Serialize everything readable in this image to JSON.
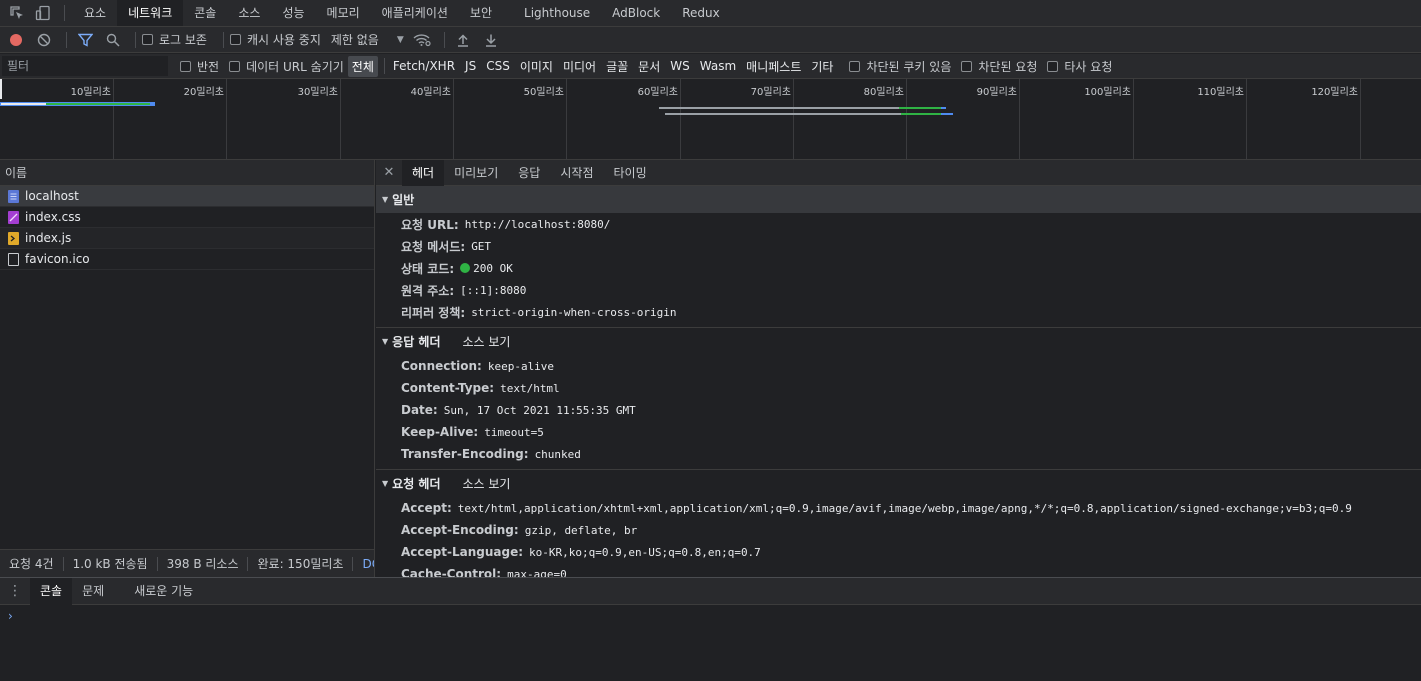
{
  "main_tabs": [
    "요소",
    "네트워크",
    "콘솔",
    "소스",
    "성능",
    "메모리",
    "애플리케이션",
    "보안",
    "Lighthouse",
    "AdBlock",
    "Redux"
  ],
  "main_tab_active": 1,
  "toolbar": {
    "preserve_log": "로그 보존",
    "disable_cache": "캐시 사용 중지",
    "throttle": "제한 없음"
  },
  "filter": {
    "placeholder": "필터",
    "invert": "반전",
    "hide_data_urls": "데이터 URL 숨기기",
    "types": [
      "전체",
      "Fetch/XHR",
      "JS",
      "CSS",
      "이미지",
      "미디어",
      "글꼴",
      "문서",
      "WS",
      "Wasm",
      "매니페스트",
      "기타"
    ],
    "blocked_cookies": "차단된 쿠키 있음",
    "blocked_requests": "차단된 요청",
    "third_party": "타사 요청"
  },
  "overview": {
    "ticks": [
      "10밀리초",
      "20밀리초",
      "30밀리초",
      "40밀리초",
      "50밀리초",
      "60밀리초",
      "70밀리초",
      "80밀리초",
      "90밀리초",
      "100밀리초",
      "110밀리초",
      "120밀리초"
    ]
  },
  "name_panel": {
    "header": "이름",
    "rows": [
      {
        "name": "localhost",
        "type": "doc"
      },
      {
        "name": "index.css",
        "type": "css"
      },
      {
        "name": "index.js",
        "type": "js"
      },
      {
        "name": "favicon.ico",
        "type": "other"
      }
    ]
  },
  "status": {
    "requests": "요청 4건",
    "transferred": "1.0 kB 전송됨",
    "resources": "398 B 리소스",
    "finish": "완료: 150밀리초",
    "dom": "DOMC"
  },
  "details": {
    "tabs": [
      "헤더",
      "미리보기",
      "응답",
      "시작점",
      "타이밍"
    ],
    "general": {
      "title": "일반",
      "url_k": "요청 URL:",
      "url_v": "http://localhost:8080/",
      "method_k": "요청 메서드:",
      "method_v": "GET",
      "status_k": "상태 코드:",
      "status_v": "200 OK",
      "remote_k": "원격 주소:",
      "remote_v": "[::1]:8080",
      "referrer_k": "리퍼러 정책:",
      "referrer_v": "strict-origin-when-cross-origin"
    },
    "response": {
      "title": "응답 헤더",
      "view_source": "소스 보기",
      "headers": [
        {
          "k": "Connection:",
          "v": "keep-alive"
        },
        {
          "k": "Content-Type:",
          "v": "text/html"
        },
        {
          "k": "Date:",
          "v": "Sun, 17 Oct 2021 11:55:35 GMT"
        },
        {
          "k": "Keep-Alive:",
          "v": "timeout=5"
        },
        {
          "k": "Transfer-Encoding:",
          "v": "chunked"
        }
      ]
    },
    "request": {
      "title": "요청 헤더",
      "view_source": "소스 보기",
      "headers": [
        {
          "k": "Accept:",
          "v": "text/html,application/xhtml+xml,application/xml;q=0.9,image/avif,image/webp,image/apng,*/*;q=0.8,application/signed-exchange;v=b3;q=0.9"
        },
        {
          "k": "Accept-Encoding:",
          "v": "gzip, deflate, br"
        },
        {
          "k": "Accept-Language:",
          "v": "ko-KR,ko;q=0.9,en-US;q=0.8,en;q=0.7"
        },
        {
          "k": "Cache-Control:",
          "v": "max-age=0"
        }
      ]
    }
  },
  "drawer": {
    "tabs": [
      "콘솔",
      "문제",
      "새로운 기능"
    ],
    "prompt": "›"
  },
  "colors": {
    "accent_blue": "#7cacf8",
    "record_red": "#e46962",
    "status_green": "#2fb344"
  }
}
